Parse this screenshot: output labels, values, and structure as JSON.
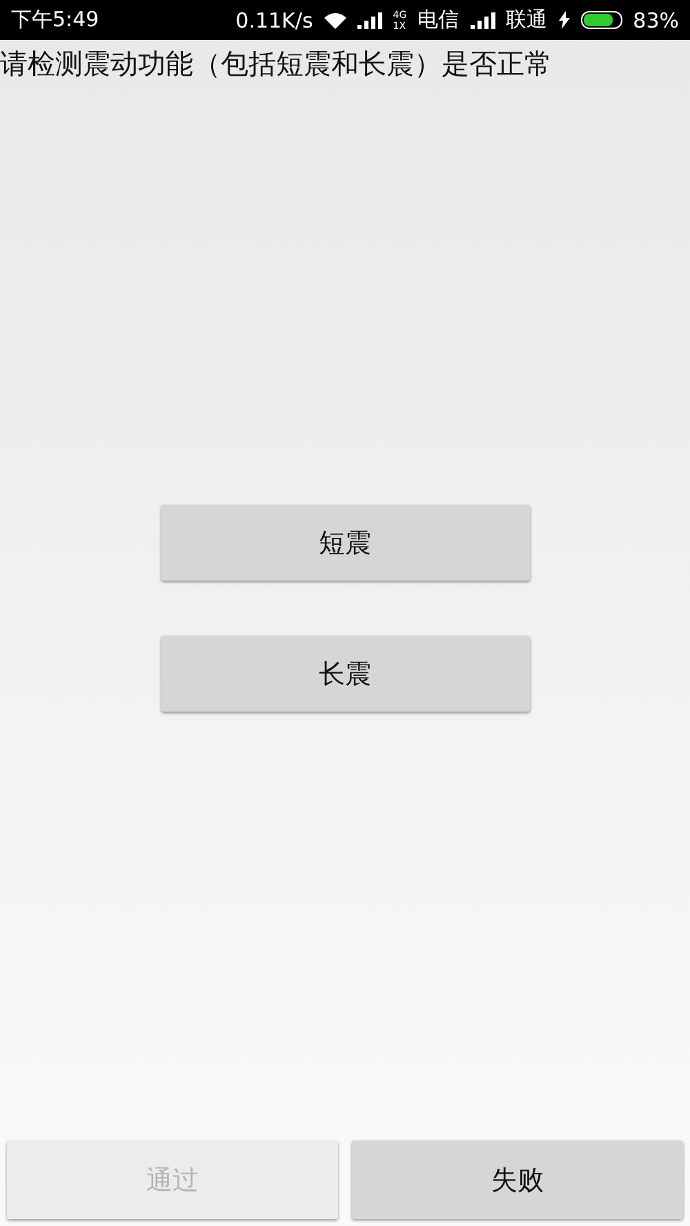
{
  "status_bar": {
    "time": "下午5:49",
    "speed": "0.11K/s",
    "network_tags": [
      "4G",
      "1X"
    ],
    "carriers": [
      "电信",
      "联通"
    ],
    "battery": {
      "level": 0.83,
      "charging": true,
      "percent": "83%"
    }
  },
  "prompt": "请检测震动功能（包括短震和长震）是否正常",
  "test_buttons": [
    "短震",
    "长震"
  ],
  "footer_buttons": [
    {
      "label": "通过",
      "disabled": true
    },
    {
      "label": "失败",
      "disabled": false
    }
  ]
}
